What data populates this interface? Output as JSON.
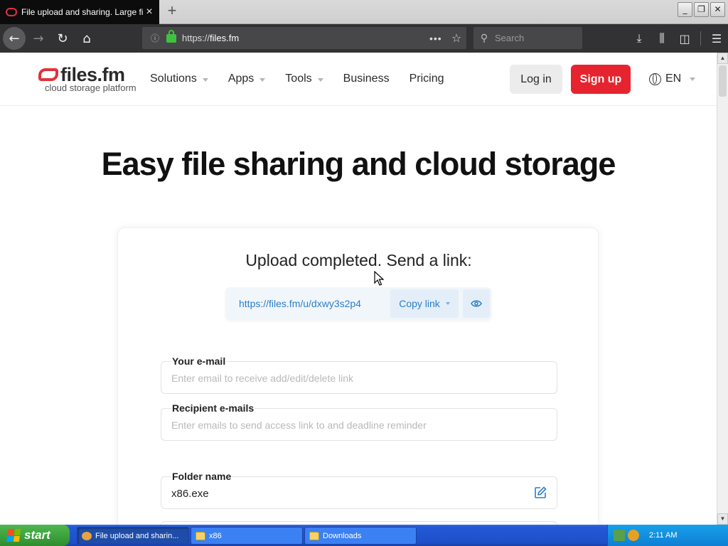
{
  "browser": {
    "tab_title": "File upload and sharing. Large file",
    "tab_close": "×",
    "new_tab": "+",
    "window_buttons": [
      "_",
      "❐",
      "✕"
    ],
    "url_prefix": "https://",
    "url_domain": "files.fm",
    "url_more": "•••",
    "search_placeholder": "Search",
    "toolbar_icons": [
      "download-icon",
      "library-icon",
      "sidebar-icon",
      "menu-icon"
    ]
  },
  "site": {
    "logo_name": "files.fm",
    "logo_tagline": "cloud storage platform",
    "menu": [
      {
        "label": "Solutions",
        "dropdown": true
      },
      {
        "label": "Apps",
        "dropdown": true
      },
      {
        "label": "Tools",
        "dropdown": true
      },
      {
        "label": "Business",
        "dropdown": false
      },
      {
        "label": "Pricing",
        "dropdown": false
      }
    ],
    "login_label": "Log in",
    "signup_label": "Sign up",
    "language": "EN",
    "brand_color": "#e6242f"
  },
  "hero_title": "Easy file sharing and cloud storage",
  "upload": {
    "title": "Upload completed. Send a link:",
    "share_url": "https://files.fm/u/dxwy3s2p4",
    "copy_label": "Copy link",
    "link_color": "#2b7fc9",
    "fields": [
      {
        "label": "Your e-mail",
        "value": "",
        "placeholder": "Enter email to receive add/edit/delete link"
      },
      {
        "label": "Recipient e-mails",
        "value": "",
        "placeholder": "Enter emails to send access link to and deadline reminder"
      },
      {
        "label": "Folder name",
        "value": "x86.exe",
        "placeholder": ""
      }
    ]
  },
  "taskbar": {
    "start_label": "start",
    "tasks": [
      {
        "label": "File upload and sharin...",
        "icon": "firefox-icon",
        "active": true
      },
      {
        "label": "x86",
        "icon": "folder-icon",
        "active": false
      },
      {
        "label": "Downloads",
        "icon": "folder-icon",
        "active": false
      }
    ],
    "clock": "2:11 AM"
  }
}
